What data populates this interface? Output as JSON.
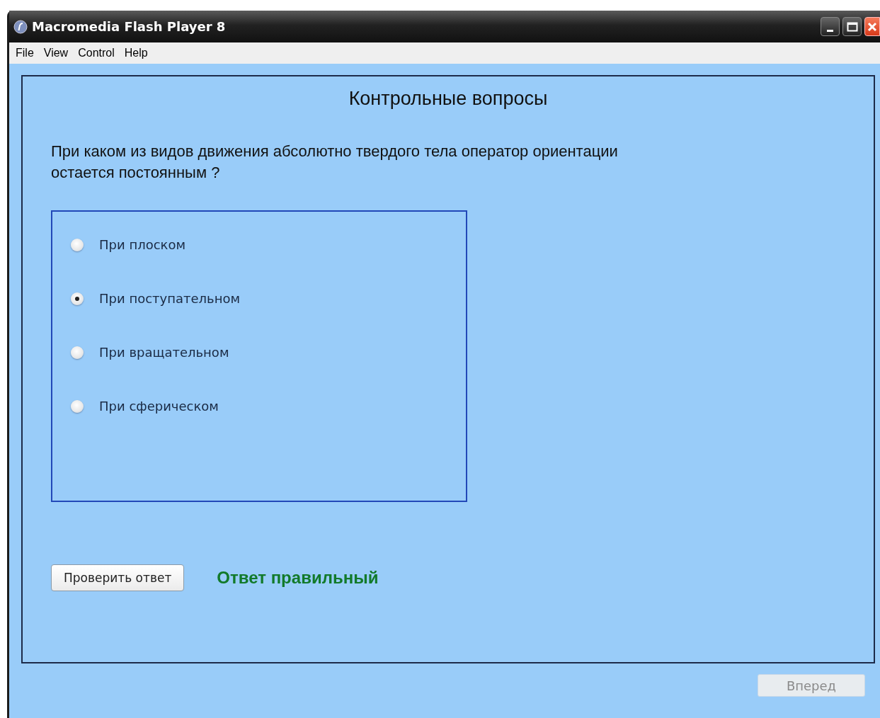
{
  "window": {
    "title": "Macromedia Flash Player 8"
  },
  "menu": [
    "File",
    "View",
    "Control",
    "Help"
  ],
  "heading": "Контрольные вопросы",
  "question": "При каком из видов движения абсолютно твердого тела оператор ориентации остается постоянным ?",
  "options": [
    {
      "label": "При плоском",
      "selected": false
    },
    {
      "label": "При поступательном",
      "selected": true
    },
    {
      "label": "При вращательном",
      "selected": false
    },
    {
      "label": "При сферическом",
      "selected": false
    }
  ],
  "check_button": {
    "label": "Проверить ответ"
  },
  "result": {
    "text": "Ответ правильный",
    "correct": true
  },
  "next_button": {
    "label": "Вперед",
    "disabled": true
  }
}
